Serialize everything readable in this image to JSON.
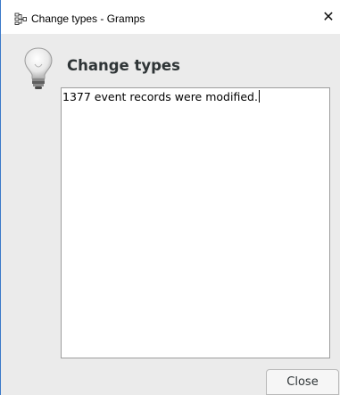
{
  "window": {
    "title": "Change types - Gramps",
    "close_glyph": "✕"
  },
  "dialog": {
    "heading": "Change types",
    "icon": "lightbulb-icon",
    "message": "1377 event records were modified."
  },
  "buttons": {
    "close_label": "Close"
  },
  "colors": {
    "dialog_bg": "#ebebeb",
    "window_border": "#3a79c9",
    "heading_text": "#2e3436"
  }
}
